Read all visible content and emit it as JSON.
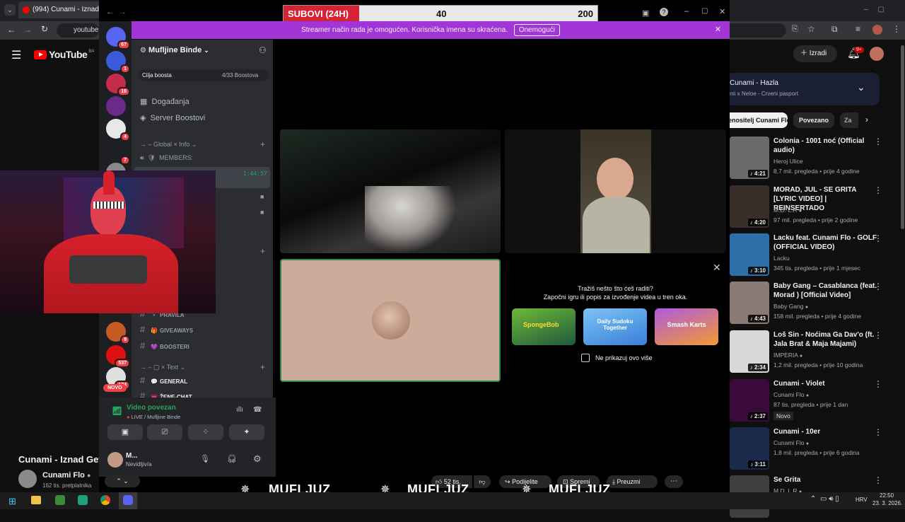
{
  "browser": {
    "tab_title": "(994) Cunami - Iznad Geta",
    "url_prefix": "youtube"
  },
  "youtube": {
    "logo": "YouTube",
    "region": "BA",
    "create_label": "Izradi",
    "notif_count": "9+",
    "video_title": "Cunami - Iznad Geta",
    "channel_name": "Cunami Flo",
    "subscribers": "162 tis. pretplatnika",
    "likes": "52 tis.",
    "share": "Podijelite",
    "save": "Spremi",
    "download": "Preuzmi",
    "playlist_title": "Cunami - Hazla",
    "playlist_sub": "mi x Neloe - Crveni pasport",
    "chips": [
      "enositelj Cunami Flo",
      "Povezano",
      "Za"
    ],
    "recs": [
      {
        "title": "Colonia - 1001 noć (Official audio)",
        "channel": "Heroj Ulice",
        "meta": "8,7 mil. pregleda • prije 4 godine",
        "duration": "4:21",
        "color": "#6a6a6a",
        "verified": false
      },
      {
        "title": "MORAD, JUL - SE GRITA [LYRIC VIDEO] | REINSERTADO",
        "channel": "M.D. L.R",
        "meta": "97 mil. pregleda • prije 2 godine",
        "duration": "4:20",
        "color": "#3a2e2a",
        "verified": true
      },
      {
        "title": "Lacku feat. Cunami Flo - GOLF (OFFICIAL VIDEO)",
        "channel": "Lacku",
        "meta": "345 tis. pregleda • prije 1 mjesec",
        "duration": "3:10",
        "color": "#2d6fa8",
        "verified": false
      },
      {
        "title": "Baby Gang – Casablanca (feat. Morad ) [Official Video]",
        "channel": "Baby Gang",
        "meta": "158 mil. pregleda • prije 4 godine",
        "duration": "4:43",
        "color": "#8a7a74",
        "verified": true
      },
      {
        "title": "Loš Sin - Noćima Ga Dav'o (ft. Jala Brat & Maja Majami)",
        "channel": "IMPERIA",
        "meta": "1,2 mil. pregleda • prije 10 godina",
        "duration": "2:34",
        "color": "#d8d8d8",
        "verified": true
      },
      {
        "title": "Cunami - Violet",
        "channel": "Cunami Flo",
        "meta": "87 tis. pregleda • prije 1 dan",
        "duration": "2:37",
        "color": "#3a0a3a",
        "verified": true,
        "badge": "Novo"
      },
      {
        "title": "Cunami - 10er",
        "channel": "Cunami Flo",
        "meta": "1,8 mil. pregleda • prije 6 godina",
        "duration": "3:11",
        "color": "#1a2a4a",
        "verified": true
      },
      {
        "title": "Se Grita",
        "channel": "M.D. L.R",
        "meta": "",
        "duration": "",
        "color": "#404040",
        "verified": true
      }
    ]
  },
  "subgoal": {
    "label": "SUBOVI (24H)",
    "current": "40",
    "target": "200",
    "progress": 0.2
  },
  "discord": {
    "streamer_banner": "Streamer način rada je omogućen. Korisnička imena su skraćena.",
    "disable_button": "Onemogući",
    "server_name": "Mufljine Binde",
    "boost_goal": "Cilja boosta",
    "boost_count": "4/33 Boostova",
    "events": "Događanja",
    "server_boosts": "Server Boostovi",
    "cat_global": "Global × Info",
    "members_label": "MEMBERS:",
    "timestamp": "1:44:57",
    "channels": [
      {
        "name": "PRAVILA",
        "emoji": "🔹"
      },
      {
        "name": "GIVEAWAYS",
        "emoji": "🎁"
      },
      {
        "name": "BOOSTERI",
        "emoji": "💜"
      }
    ],
    "cat_text": "× Text",
    "text_channels": [
      {
        "name": "GENERAL",
        "emoji": "💬"
      },
      {
        "name": "ŽENE-CHAT",
        "emoji": "💗"
      }
    ],
    "server_badges": [
      "67",
      "1",
      "16",
      "4",
      "7",
      "26",
      "9",
      "537",
      "174"
    ],
    "new_badge": "NOVO",
    "voice_status": "Video povezan",
    "voice_channel": "LIVE / Mufljine Binde",
    "user_name": "M...",
    "user_status": "Nevidljiv/a",
    "activity_title": "Tražiš nešto što ćeš raditi?",
    "activity_sub": "Započni igru ili popis za izvođenje videa u tren oka.",
    "games": [
      "SpongeBob",
      "Daily Sudoku Together",
      "Smash Karts"
    ],
    "dont_show": "Ne prikazuj ovo više"
  },
  "overlay": {
    "brand": "MUFLJUZ"
  },
  "taskbar": {
    "lang": "HRV",
    "time": "22:50",
    "date": "23. 3. 2026."
  }
}
